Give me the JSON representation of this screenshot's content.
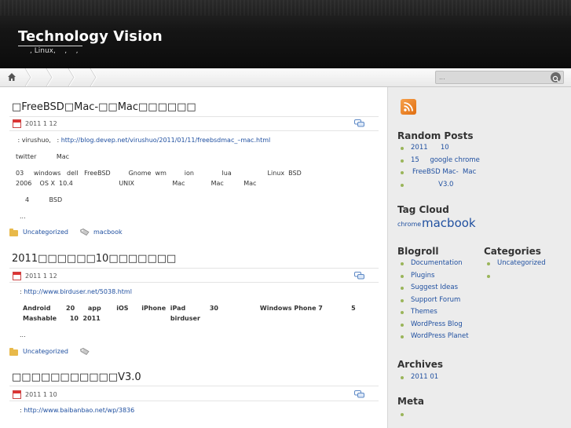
{
  "header": {
    "site_title": "Technology Vision",
    "site_desc": ", Linux,    ,    ,"
  },
  "search": {
    "placeholder": "..."
  },
  "posts": [
    {
      "title": "□FreeBSD□Mac-□□Mac□□□□□□",
      "date": "2011 1 12",
      "source_prefix": " : virushuo,   : ",
      "source_url": "http://blog.devep.net/virushuo/2011/01/11/freebsdmac_–mac.html",
      "line2": "twitter          Mac",
      "line3": "03     windows   dell   FreeBSD         Gnome  wm         ion              lua                  Linux  BSD",
      "line4": "2006    OS X  10.4                       UNIX                   Mac             Mac          Mac",
      "line5": "4          BSD",
      "ellipsis": "...",
      "category": "Uncategorized",
      "tag": "macbook"
    },
    {
      "title": "2011□□□□□□10□□□□□□□",
      "date": "2011 1 12",
      "source_prefix": ": ",
      "source_url": "http://www.birduser.net/5038.html",
      "line2": "Android       20      app       iOS      iPhone  iPad           30                   Windows Phone 7             5",
      "line3": "Mashable      10  2011                                birduser",
      "ellipsis": "...",
      "category": "Uncategorized"
    },
    {
      "title": "□□□□□□□□□□□V3.0",
      "date": "2011 1 10",
      "source_prefix": ": ",
      "source_url": "http://www.baibanbao.net/wp/3836"
    }
  ],
  "sidebar": {
    "random_posts_heading": "Random Posts",
    "random_posts": [
      "2011      10",
      "15     google chrome",
      "FreeBSD Mac-  Mac",
      "             V3.0"
    ],
    "tag_cloud_heading": "Tag Cloud",
    "tags": [
      "chrome",
      "macbook"
    ],
    "blogroll_heading": "Blogroll",
    "blogroll": [
      "Documentation",
      "Plugins",
      "Suggest Ideas",
      "Support Forum",
      "Themes",
      "WordPress Blog",
      "WordPress Planet"
    ],
    "categories_heading": "Categories",
    "categories": [
      "Uncategorized",
      ""
    ],
    "archives_heading": "Archives",
    "archives": [
      "2011 01"
    ],
    "meta_heading": "Meta",
    "meta": [
      ""
    ]
  },
  "colors": {
    "link": "#2050a0",
    "header_bg": "#111111",
    "bullet": "#9ab55a",
    "rss": "#f08a2a"
  }
}
